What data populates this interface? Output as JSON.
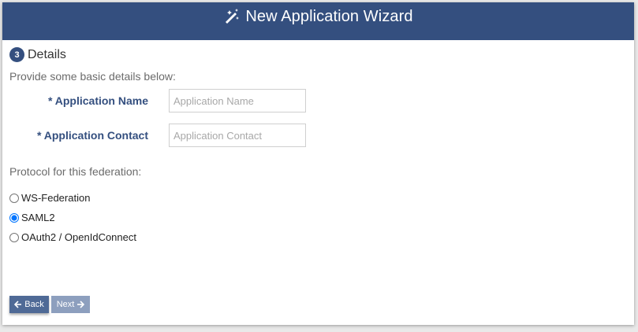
{
  "header": {
    "title": "New Application Wizard",
    "icon": "magic-wand-icon",
    "background_color": "#344f7f"
  },
  "step": {
    "number": "3",
    "title": "Details"
  },
  "intro": "Provide some basic details below:",
  "fields": [
    {
      "label": "* Application Name",
      "value": "",
      "placeholder": "Application Name"
    },
    {
      "label": "* Application Contact",
      "value": "",
      "placeholder": "Application Contact"
    }
  ],
  "protocol": {
    "label": "Protocol for this federation:",
    "options": [
      {
        "label": "WS-Federation",
        "selected": false
      },
      {
        "label": "SAML2",
        "selected": true
      },
      {
        "label": "OAuth2 / OpenIdConnect",
        "selected": false
      }
    ]
  },
  "buttons": {
    "back_label": "Back",
    "next_label": "Next"
  }
}
